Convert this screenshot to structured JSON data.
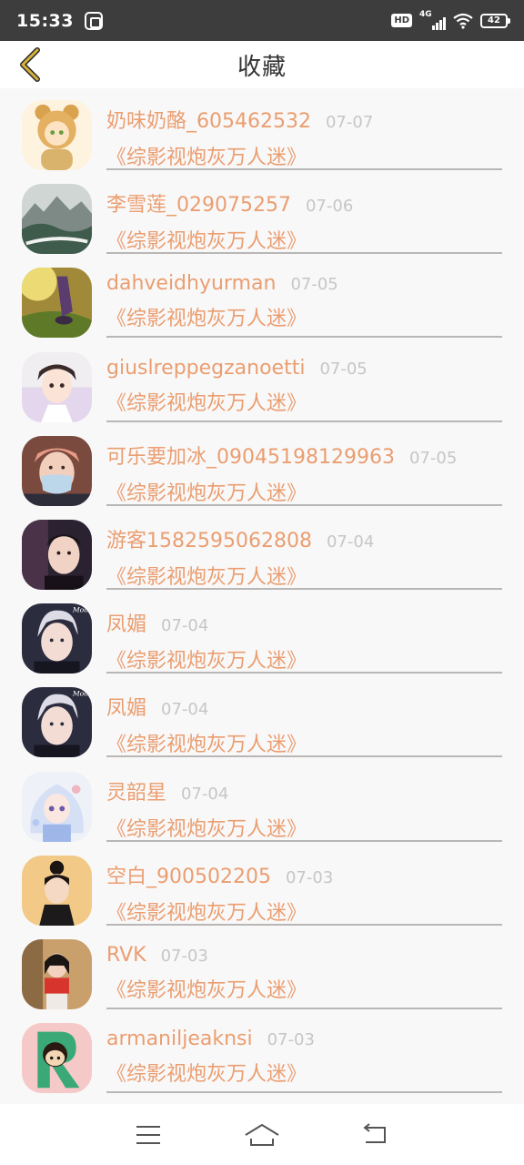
{
  "status_bar": {
    "time": "15:33",
    "hd": "HD",
    "network": "4G",
    "battery": "42"
  },
  "header": {
    "title": "收藏",
    "back_icon": "chevron-left-icon",
    "accent_color": "#c8a032"
  },
  "items": [
    {
      "name": "奶味奶酪_605462532",
      "date": "07-07",
      "title": "《综影视炮灰万人迷》",
      "avatar": "bear-girl"
    },
    {
      "name": "李雪莲_029075257",
      "date": "07-06",
      "title": "《综影视炮灰万人迷》",
      "avatar": "landscape"
    },
    {
      "name": "dahveidhyurman",
      "date": "07-05",
      "title": "《综影视炮灰万人迷》",
      "avatar": "feet-grass"
    },
    {
      "name": "giuslreppegzanoetti",
      "date": "07-05",
      "title": "《综影视炮灰万人迷》",
      "avatar": "anime-boy"
    },
    {
      "name": "可乐要加冰_09045198129963",
      "date": "07-05",
      "title": "《综影视炮灰万人迷》",
      "avatar": "mask-boy"
    },
    {
      "name": "游客1582595062808",
      "date": "07-04",
      "title": "《综影视炮灰万人迷》",
      "avatar": "selfie-boy"
    },
    {
      "name": "凤媚",
      "date": "07-04",
      "title": "《综影视炮灰万人迷》",
      "avatar": "silver-hair-boy"
    },
    {
      "name": "凤媚",
      "date": "07-04",
      "title": "《综影视炮灰万人迷》",
      "avatar": "silver-hair-boy"
    },
    {
      "name": "灵韶星",
      "date": "07-04",
      "title": "《综影视炮灰万人迷》",
      "avatar": "anime-girl"
    },
    {
      "name": "空白_900502205",
      "date": "07-03",
      "title": "《综影视炮灰万人迷》",
      "avatar": "girl-bun"
    },
    {
      "name": "RVK",
      "date": "07-03",
      "title": "《综影视炮灰万人迷》",
      "avatar": "girl-red"
    },
    {
      "name": "armaniljeaknsi",
      "date": "07-03",
      "title": "《综影视炮灰万人迷》",
      "avatar": "letter-r"
    }
  ],
  "nav_bar": {
    "menu_icon": "menu-icon",
    "home_icon": "home-icon",
    "back_icon": "return-icon"
  },
  "colors": {
    "name_text": "#ea9e70",
    "date_text": "#c6c6c6",
    "divider": "#b9b7b6",
    "status_bar_bg": "#3d3d3d"
  }
}
